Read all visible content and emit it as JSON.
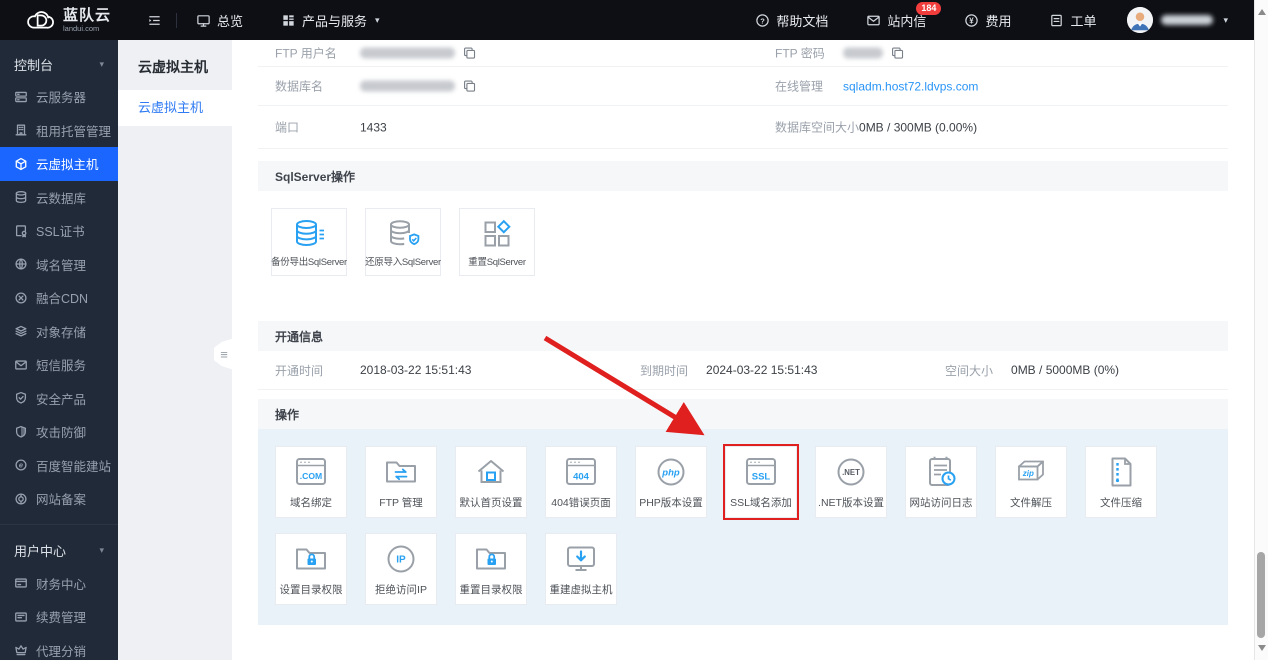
{
  "topbar": {
    "logo": {
      "title": "蓝队云",
      "subtitle": "landui.com"
    },
    "menu": [
      {
        "label": "总览",
        "icon": "monitor-icon"
      },
      {
        "label": "产品与服务",
        "icon": "grid-icon",
        "caret": "▾"
      }
    ],
    "right_menu": [
      {
        "label": "帮助文档",
        "icon": "help-icon"
      },
      {
        "label": "站内信",
        "icon": "mail-icon",
        "badge": "184"
      },
      {
        "label": "费用",
        "icon": "fee-icon"
      },
      {
        "label": "工单",
        "icon": "ticket-icon"
      }
    ],
    "user_caret": "▾"
  },
  "sidebar": {
    "sections": [
      {
        "title": "控制台",
        "items": [
          {
            "label": "云服务器",
            "icon": "server-icon"
          },
          {
            "label": "租用托管管理",
            "icon": "building-icon"
          },
          {
            "label": "云虚拟主机",
            "icon": "cube-icon",
            "active": true
          },
          {
            "label": "云数据库",
            "icon": "database-icon"
          },
          {
            "label": "SSL证书",
            "icon": "certificate-icon"
          },
          {
            "label": "域名管理",
            "icon": "globe-icon"
          },
          {
            "label": "融合CDN",
            "icon": "cdn-icon"
          },
          {
            "label": "对象存储",
            "icon": "layers-icon"
          },
          {
            "label": "短信服务",
            "icon": "envelope-icon"
          },
          {
            "label": "安全产品",
            "icon": "shield-icon"
          },
          {
            "label": "攻击防御",
            "icon": "shield-half-icon"
          },
          {
            "label": "百度智能建站",
            "icon": "browser-e-icon"
          },
          {
            "label": "网站备案",
            "icon": "record-icon"
          }
        ]
      },
      {
        "title": "用户中心",
        "items": [
          {
            "label": "财务中心",
            "icon": "wallet-icon"
          },
          {
            "label": "续费管理",
            "icon": "card-icon"
          },
          {
            "label": "代理分销",
            "icon": "crown-icon"
          }
        ]
      }
    ]
  },
  "subsidebar": {
    "title": "云虚拟主机",
    "items": [
      {
        "label": "云虚拟主机",
        "active": true
      }
    ]
  },
  "details": {
    "rows": [
      {
        "left": {
          "label": "FTP 用户名",
          "masked": true,
          "copy": true
        },
        "right": {
          "label": "FTP 密码",
          "masked": true,
          "copy": true
        }
      },
      {
        "left": {
          "label": "数据库名",
          "masked": true,
          "copy": true
        },
        "right": {
          "label": "在线管理",
          "link": "sqladm.host72.ldvps.com"
        }
      },
      {
        "left": {
          "label": "端口",
          "value": "1433"
        },
        "right": {
          "label": "数据库空间大小",
          "value": "0MB / 300MB (0.00%)"
        }
      }
    ]
  },
  "sqlserver": {
    "title": "SqlServer操作",
    "cards": [
      {
        "label": "备份导出SqlServer",
        "icon": "db-export-icon"
      },
      {
        "label": "还原导入SqlServer",
        "icon": "db-import-icon"
      },
      {
        "label": "重置SqlServer",
        "icon": "reset-sql-icon"
      }
    ]
  },
  "open_info": {
    "title": "开通信息",
    "fields": [
      {
        "label": "开通时间",
        "value": "2018-03-22 15:51:43"
      },
      {
        "label": "到期时间",
        "value": "2024-03-22 15:51:43"
      },
      {
        "label": "空间大小",
        "value": "0MB / 5000MB (0%)"
      }
    ]
  },
  "actions": {
    "title": "操作",
    "cards": [
      {
        "label": "域名绑定",
        "icon": "com-browser-icon"
      },
      {
        "label": "FTP 管理",
        "icon": "ftp-folder-icon"
      },
      {
        "label": "默认首页设置",
        "icon": "home-icon"
      },
      {
        "label": "404错误页面",
        "icon": "error-404-icon"
      },
      {
        "label": "PHP版本设置",
        "icon": "php-icon"
      },
      {
        "label": "SSL域名添加",
        "icon": "ssl-browser-icon",
        "highlighted": true
      },
      {
        "label": ".NET版本设置",
        "icon": "dotnet-icon"
      },
      {
        "label": "网站访问日志",
        "icon": "access-log-icon"
      },
      {
        "label": "文件解压",
        "icon": "unzip-icon"
      },
      {
        "label": "文件压缩",
        "icon": "compress-icon"
      },
      {
        "label": "设置目录权限",
        "icon": "folder-lock-icon"
      },
      {
        "label": "拒绝访问IP",
        "icon": "ip-ban-icon"
      },
      {
        "label": "重置目录权限",
        "icon": "folder-lock2-icon"
      },
      {
        "label": "重建虚拟主机",
        "icon": "rebuild-host-icon"
      }
    ]
  },
  "colors": {
    "accent_blue": "#1a66ff",
    "icon_blue": "#29a1f2",
    "link_blue": "#2a95f5",
    "highlight_red": "#e01f1f",
    "topbar_bg": "#0d0f14",
    "sidebar_bg": "#212a38"
  }
}
